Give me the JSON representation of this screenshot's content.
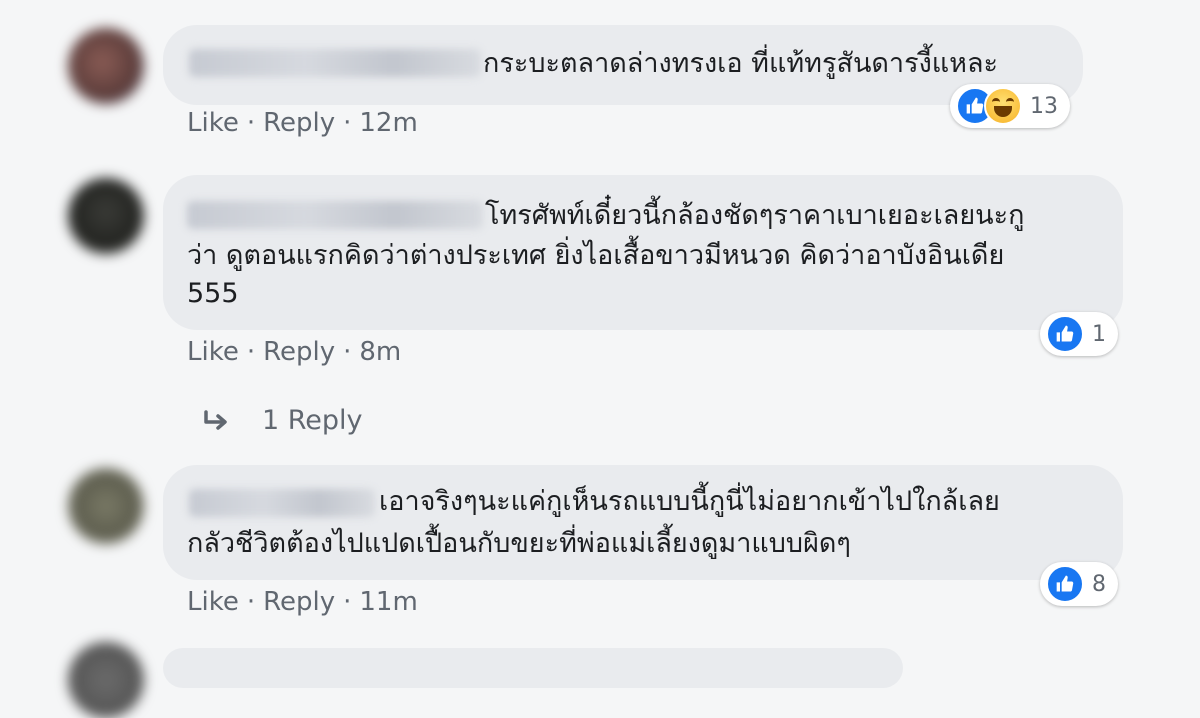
{
  "comments": [
    {
      "text_lines": [
        "กระบะตลาดล่างทรงเอ ที่แท้ทรูสันดารงี้แหละ"
      ],
      "actions": {
        "like": "Like",
        "reply": "Reply",
        "time": "12m"
      },
      "reaction_count": "13",
      "reaction_icons": [
        "like-icon",
        "haha-icon"
      ]
    },
    {
      "text_lines": [
        "โทรศัพท์เดี๋ยวนี้กล้องชัดๆราคาเบาเยอะเลยนะกู",
        "ว่า ดูตอนแรกคิดว่าต่างประเทศ ยิ่งไอเสื้อขาวมีหนวด คิดว่าอาบังอินเดีย",
        "555"
      ],
      "actions": {
        "like": "Like",
        "reply": "Reply",
        "time": "8m"
      },
      "reaction_count": "1",
      "reaction_icons": [
        "like-icon"
      ],
      "replies_label": "1 Reply"
    },
    {
      "text_lines": [
        "เอาจริงๆนะแค่กูเห็นรถแบบนี้กูนี่ไม่อยากเข้าไปใกล้เลย",
        "กลัวชีวิตต้องไปแปดเปื้อนกับขยะที่พ่อแม่เลี้ยงดูมาแบบผิดๆ"
      ],
      "actions": {
        "like": "Like",
        "reply": "Reply",
        "time": "11m"
      },
      "reaction_count": "8",
      "reaction_icons": [
        "like-icon"
      ]
    }
  ],
  "colors": {
    "bubble": "#e9ebee",
    "meta": "#606770",
    "like_blue": "#1877f2",
    "background": "#f5f6f7"
  }
}
